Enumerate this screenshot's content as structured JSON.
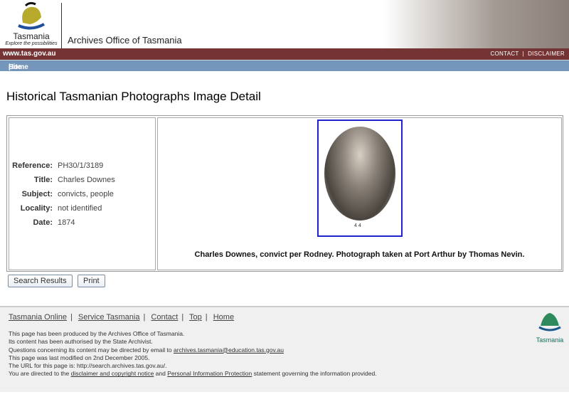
{
  "header": {
    "logo_title": "Tasmania",
    "logo_slogan": "Explore the possibilities",
    "site_name": "Archives Office of Tasmania",
    "url": "www.tas.gov.au",
    "contact": "CONTACT",
    "separator": "|",
    "disclaimer": "DISCLAIMER"
  },
  "nav": {
    "home": "Home",
    "sep": "|",
    "sitemap": "Site map"
  },
  "page_title": "Historical Tasmanian Photographs Image Detail",
  "details": [
    {
      "label": "Reference:",
      "value": "PH30/1/3189"
    },
    {
      "label": "Title:",
      "value": "Charles Downes"
    },
    {
      "label": "Subject:",
      "value": "convicts, people"
    },
    {
      "label": "Locality:",
      "value": "not identified"
    },
    {
      "label": "Date:",
      "value": "1874"
    }
  ],
  "image": {
    "signature": "4 4",
    "caption": "Charles Downes, convict per Rodney. Photograph taken at Port Arthur by Thomas Nevin."
  },
  "buttons": {
    "search_results": "Search Results",
    "print": "Print"
  },
  "footer": {
    "links": [
      "Tasmania Online",
      "Service Tasmania",
      "Contact",
      "Top",
      "Home"
    ],
    "line1": "This page has been produced by the Archives Office of Tasmania.",
    "line2": "Its content has been authorised by the State Archivist.",
    "line3": "Questions concerning its content may be directed by email to ",
    "email": "archives.tasmania@education.tas.gov.au",
    "line4": "This page was last modified on 2nd December 2005.",
    "line5": "The URL for this page is: http://search.archives.tas.gov.au/.",
    "line6a": "You are directed to the ",
    "disclaimer_link": "disclaimer and copyright notice",
    "line6b": " and ",
    "privacy_link": "Personal Information Protection",
    "line6c": " statement governing the information provided.",
    "logo_text": "Tasmania"
  }
}
